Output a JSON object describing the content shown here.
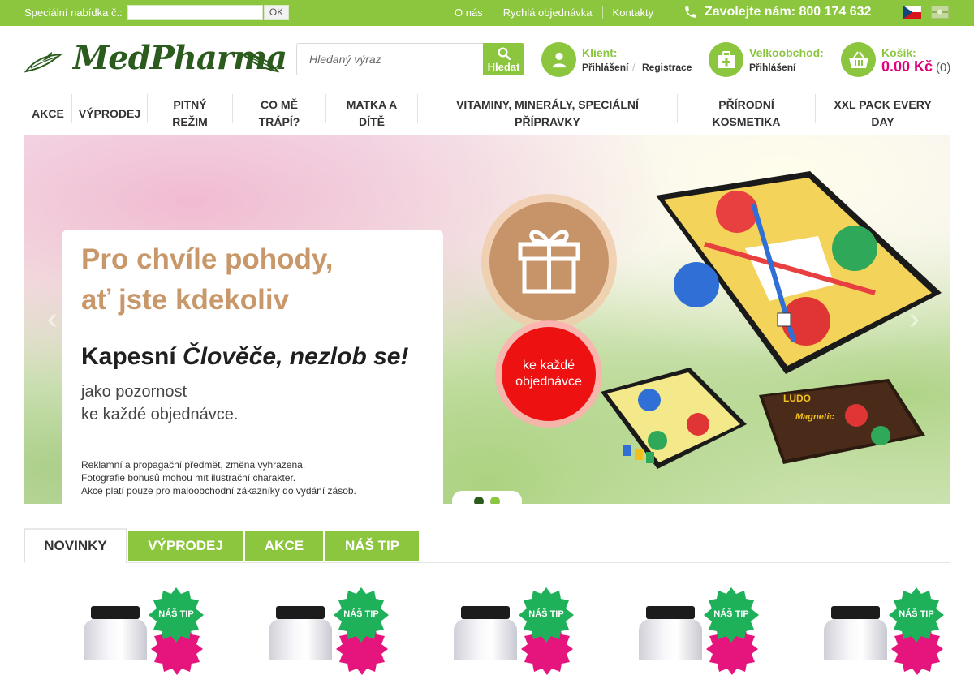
{
  "topbar": {
    "offer_label": "Speciální nabídka č.:",
    "offer_value": "",
    "ok_label": "OK",
    "links": [
      "O nás",
      "Rychlá objednávka",
      "Kontakty"
    ],
    "phone": "Zavolejte nám: 800 174 632"
  },
  "header": {
    "logo": "MedPharma",
    "search_placeholder": "Hledaný výraz",
    "search_button": "Hledat",
    "client": {
      "title": "Klient:",
      "login": "Přihlášení",
      "separator": "/",
      "register": "Registrace"
    },
    "wholesale": {
      "title": "Velkoobchod:",
      "login": "Přihlášení"
    },
    "cart": {
      "title": "Košík:",
      "price": "0.00 Kč",
      "count": "(0)"
    }
  },
  "nav": {
    "items": [
      "AKCE",
      "VÝPRODEJ",
      "PITNÝ REŽIM",
      "CO MĚ TRÁPÍ?",
      "MATKA A DÍTĚ",
      "VITAMINY, MINERÁLY, SPECIÁLNÍ PŘÍPRAVKY",
      "PŘÍRODNÍ KOSMETIKA",
      "XXL PACK EVERY DAY"
    ]
  },
  "banner": {
    "headline_1": "Pro chvíle pohody,",
    "headline_2": "ať jste kdekoliv",
    "title_plain": "Kapesní ",
    "title_italic": "Člověče, nezlob se!",
    "sub_1": "jako pozornost",
    "sub_2": "ke každé objednávce.",
    "fine_1": "Reklamní a propagační předmět, změna vyhrazena.",
    "fine_2": "Fotografie bonusů mohou mít ilustrační charakter.",
    "fine_3": "Akce platí pouze pro maloobchodní zákazníky do vydání zásob.",
    "badge_1": "ke každé",
    "badge_2": "objednávce",
    "box_brand": "LUDO",
    "box_text": "Magnetic",
    "slides": 2,
    "active_slide": 1
  },
  "tabs": [
    "NOVINKY",
    "VÝPRODEJ",
    "AKCE",
    "NÁŠ TIP"
  ],
  "products": [
    {
      "badge": "NÁŠ TIP"
    },
    {
      "badge": "NÁŠ TIP"
    },
    {
      "badge": "NÁŠ TIP"
    },
    {
      "badge": "NÁŠ TIP"
    },
    {
      "badge": "NÁŠ TIP"
    }
  ],
  "colors": {
    "brand_green": "#8cc63f",
    "logo_green": "#2b5c1e",
    "price_pink": "#e2007a",
    "banner_tan": "#c8986a",
    "badge_red": "#ee1111"
  }
}
